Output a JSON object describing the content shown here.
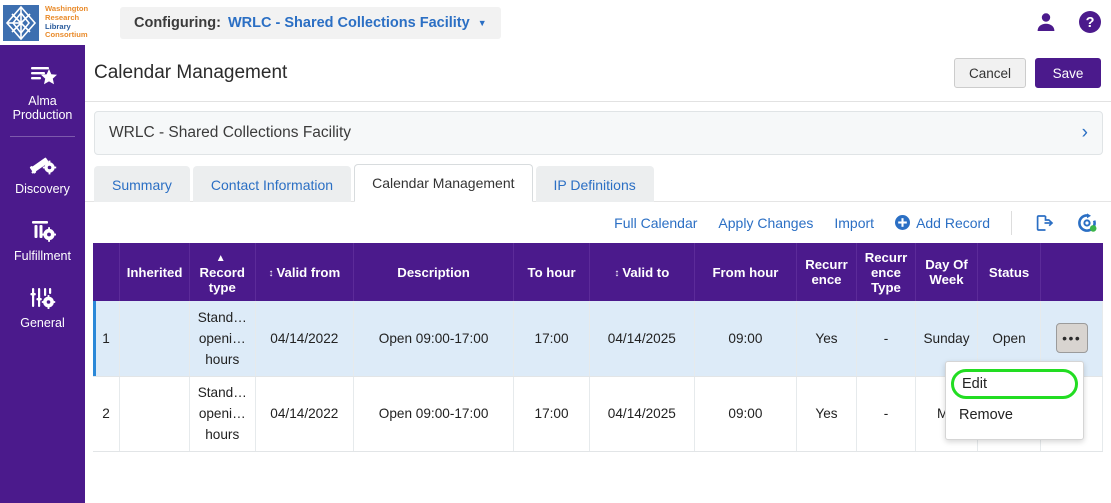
{
  "topbar": {
    "logo": {
      "lines": [
        "Washington",
        "Research",
        "Library",
        "Consortium"
      ],
      "alt": "wrlc-logo"
    },
    "configuring_label": "Configuring:",
    "configuring_value": "WRLC - Shared Collections Facility",
    "caret": "▼",
    "user_icon": "user-icon",
    "help_icon": "help-icon"
  },
  "sidebar": {
    "items": [
      {
        "label": "Alma\nProduction",
        "line1": "Alma",
        "line2": "Production",
        "icon": "alma-production-icon"
      },
      {
        "label": "Discovery",
        "line1": "Discovery",
        "line2": "",
        "icon": "discovery-icon"
      },
      {
        "label": "Fulfillment",
        "line1": "Fulfillment",
        "line2": "",
        "icon": "fulfillment-icon"
      },
      {
        "label": "General",
        "line1": "General",
        "line2": "",
        "icon": "general-icon"
      }
    ]
  },
  "page": {
    "title": "Calendar Management",
    "cancel_label": "Cancel",
    "save_label": "Save",
    "panel_title": "WRLC - Shared Collections Facility",
    "panel_chevron": "›"
  },
  "tabs": [
    {
      "label": "Summary",
      "active": false
    },
    {
      "label": "Contact Information",
      "active": false
    },
    {
      "label": "Calendar Management",
      "active": true
    },
    {
      "label": "IP Definitions",
      "active": false
    }
  ],
  "toolbar": {
    "full_calendar": "Full Calendar",
    "apply_changes": "Apply Changes",
    "import": "Import",
    "add_record": "Add Record",
    "add_record_icon": "plus-circle-icon",
    "export_icon": "export-icon",
    "settings_icon": "table-settings-icon"
  },
  "table": {
    "columns": [
      {
        "label": "",
        "key": "num"
      },
      {
        "label": "Inherited",
        "key": "inherited",
        "sort": ""
      },
      {
        "label": "Record type",
        "key": "record_type",
        "sort": "▲"
      },
      {
        "label": "Valid from",
        "key": "valid_from",
        "sort": "↕"
      },
      {
        "label": "Description",
        "key": "description",
        "sort": ""
      },
      {
        "label": "To hour",
        "key": "to_hour",
        "sort": ""
      },
      {
        "label": "Valid to",
        "key": "valid_to",
        "sort": "↕"
      },
      {
        "label": "From hour",
        "key": "from_hour",
        "sort": ""
      },
      {
        "label": "Recurrence",
        "key": "recurrence",
        "sort": ""
      },
      {
        "label": "Recurrence Type",
        "key": "recurrence_type",
        "sort": ""
      },
      {
        "label": "Day Of Week",
        "key": "day_of_week",
        "sort": ""
      },
      {
        "label": "Status",
        "key": "status",
        "sort": ""
      },
      {
        "label": "",
        "key": "actions"
      }
    ],
    "rows": [
      {
        "num": "1",
        "inherited": "",
        "record_type": "Stand… openi… hours",
        "valid_from": "04/14/2022",
        "description": "Open 09:00-17:00",
        "to_hour": "17:00",
        "valid_to": "04/14/2025",
        "from_hour": "09:00",
        "recurrence": "Yes",
        "recurrence_type": "-",
        "day_of_week": "Sunday",
        "status": "Open",
        "actions": "•••",
        "selected": true
      },
      {
        "num": "2",
        "inherited": "",
        "record_type": "Stand… openi… hours",
        "valid_from": "04/14/2022",
        "description": "Open 09:00-17:00",
        "to_hour": "17:00",
        "valid_to": "04/14/2025",
        "from_hour": "09:00",
        "recurrence": "Yes",
        "recurrence_type": "-",
        "day_of_week": "Mo",
        "status": "",
        "actions": "",
        "selected": false
      }
    ]
  },
  "row_menu": {
    "edit": "Edit",
    "remove": "Remove",
    "highlight_color": "#22dd22"
  }
}
